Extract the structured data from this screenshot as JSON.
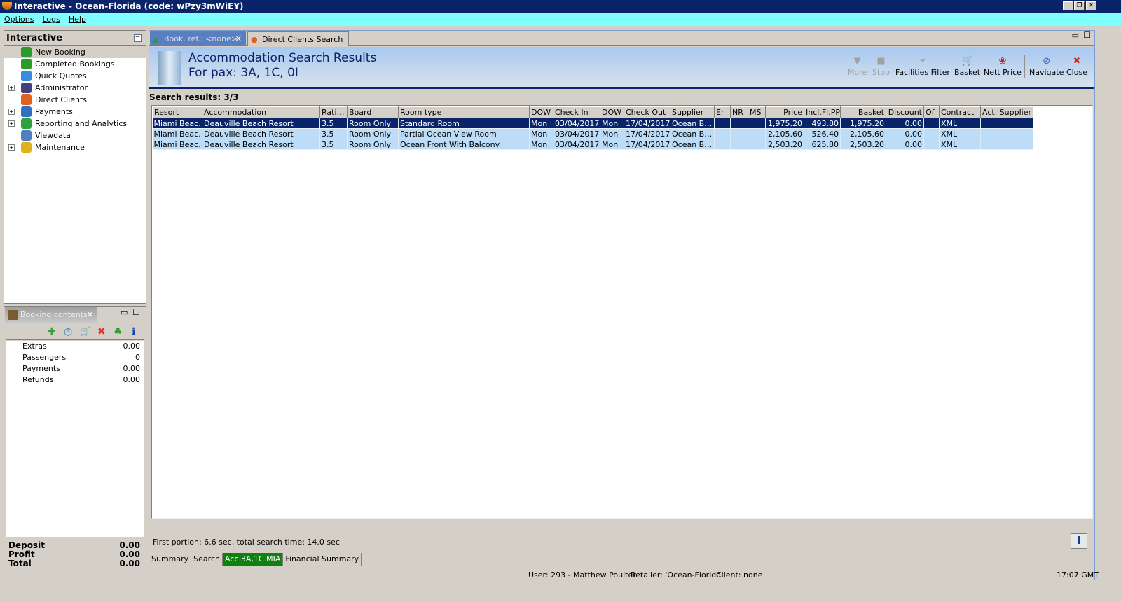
{
  "window": {
    "title": "Interactive - Ocean-Florida (code: wPzy3mWiEY)"
  },
  "menu": [
    "Options",
    "Logs",
    "Help"
  ],
  "nav": {
    "title": "Interactive",
    "items": [
      {
        "label": "New Booking",
        "expandable": false,
        "selected": true,
        "color": "#2a9a2a"
      },
      {
        "label": "Completed Bookings",
        "expandable": false,
        "color": "#2a9a2a"
      },
      {
        "label": "Quick Quotes",
        "expandable": false,
        "color": "#3a8ae0"
      },
      {
        "label": "Administrator",
        "expandable": true,
        "color": "#404080"
      },
      {
        "label": "Direct Clients",
        "expandable": false,
        "color": "#e06020"
      },
      {
        "label": "Payments",
        "expandable": true,
        "color": "#3070c0"
      },
      {
        "label": "Reporting and Analytics",
        "expandable": true,
        "color": "#30a040"
      },
      {
        "label": "Viewdata",
        "expandable": false,
        "color": "#5080c0"
      },
      {
        "label": "Maintenance",
        "expandable": true,
        "color": "#e0b020"
      }
    ]
  },
  "booking_contents": {
    "tab": "Booking contents",
    "rows": [
      {
        "label": "Extras",
        "value": "0.00"
      },
      {
        "label": "Passengers",
        "value": "0"
      },
      {
        "label": "Payments",
        "value": "0.00"
      },
      {
        "label": "Refunds",
        "value": "0.00"
      }
    ],
    "totals": [
      {
        "label": "Deposit",
        "value": "0.00"
      },
      {
        "label": "Profit",
        "value": "0.00"
      },
      {
        "label": "Total",
        "value": "0.00"
      }
    ]
  },
  "tabs": [
    "Book. ref.: <none>",
    "Direct Clients Search"
  ],
  "header": {
    "title": "Accommodation Search Results",
    "subtitle": "For pax: 3A, 1C, 0I"
  },
  "toolbar": {
    "more": "More",
    "stop": "Stop",
    "facilities": "Facilities Filter",
    "basket": "Basket",
    "nett": "Nett Price",
    "navigate": "Navigate",
    "close": "Close"
  },
  "results_label": "Search results: 3/3",
  "columns": [
    "Resort",
    "Accommodation",
    "Rati…",
    "Board",
    "Room type",
    "DOW",
    "Check In",
    "DOW",
    "Check Out",
    "Supplier",
    "Er",
    "NR",
    "MS",
    "Price",
    "Incl.Fl.PP",
    "Basket",
    "Discount",
    "Of",
    "Contract",
    "Act. Supplier"
  ],
  "rows": [
    [
      "Miami Beac…",
      "Deauville Beach Resort",
      "3.5",
      "Room Only",
      "Standard Room",
      "Mon",
      "03/04/2017",
      "Mon",
      "17/04/2017",
      "Ocean B…",
      "",
      "",
      "",
      "1,975.20",
      "493.80",
      "1,975.20",
      "0.00",
      "",
      "XML",
      ""
    ],
    [
      "Miami Beac…",
      "Deauville Beach Resort",
      "3.5",
      "Room Only",
      "Partial Ocean View Room",
      "Mon",
      "03/04/2017",
      "Mon",
      "17/04/2017",
      "Ocean B…",
      "",
      "",
      "",
      "2,105.60",
      "526.40",
      "2,105.60",
      "0.00",
      "",
      "XML",
      ""
    ],
    [
      "Miami Beac…",
      "Deauville Beach Resort",
      "3.5",
      "Room Only",
      "Ocean Front With Balcony",
      "Mon",
      "03/04/2017",
      "Mon",
      "17/04/2017",
      "Ocean B…",
      "",
      "",
      "",
      "2,503.20",
      "625.80",
      "2,503.20",
      "0.00",
      "",
      "XML",
      ""
    ]
  ],
  "selected_row": 0,
  "search_time": "First portion: 6.6 sec, total search time: 14.0 sec",
  "bottom_tabs": [
    "Summary",
    "Search",
    "Acc 3A,1C MIA",
    "Financial Summary"
  ],
  "active_bottom_tab": 2,
  "status": {
    "user": "User: 293 - Matthew Poulter",
    "retailer": "Retailer: 'Ocean-Florida'",
    "client": "Client: none",
    "time": "17:07 GMT"
  }
}
